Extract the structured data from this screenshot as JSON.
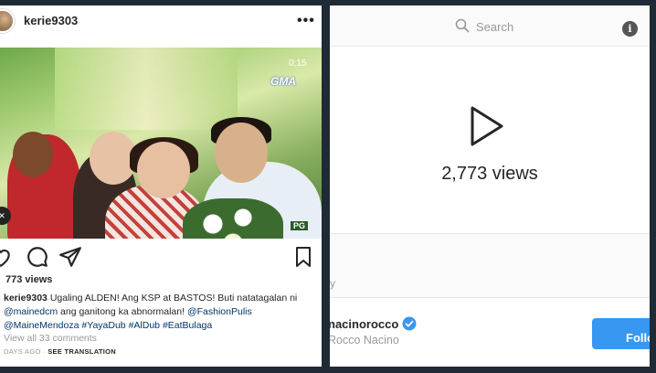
{
  "left_post": {
    "username": "kerie9303",
    "video": {
      "time": "0:15",
      "channel_logo": "GMA",
      "rating": "PG"
    },
    "views": "773 views",
    "caption": {
      "username": "kerie9303",
      "text_1": "Ugaling ALDEN! Ang KSP at BASTOS! Buti natatagalan ni",
      "mention_1": "@mainedcm",
      "text_2": "ang ganitong ka abnormalan!",
      "mention_2": "@FashionPulis",
      "mention_3": "@MaineMendoza",
      "hashtag_1": "#YayaDub",
      "hashtag_2": "#AlDub",
      "hashtag_3": "#EatBulaga"
    },
    "view_all_comments": "View all 33 comments",
    "time_ago": "DAYS AGO",
    "see_translation": "SEE TRANSLATION"
  },
  "right_post": {
    "search_placeholder": "Search",
    "views": "2,773 views",
    "stray_text": "y",
    "username": "nacinorocco",
    "full_name": "Rocco Nacino",
    "follow_label": "Follow"
  },
  "colors": {
    "background": "#1f2a36",
    "link": "#003569",
    "follow": "#3897f0",
    "verified": "#3897f0"
  }
}
